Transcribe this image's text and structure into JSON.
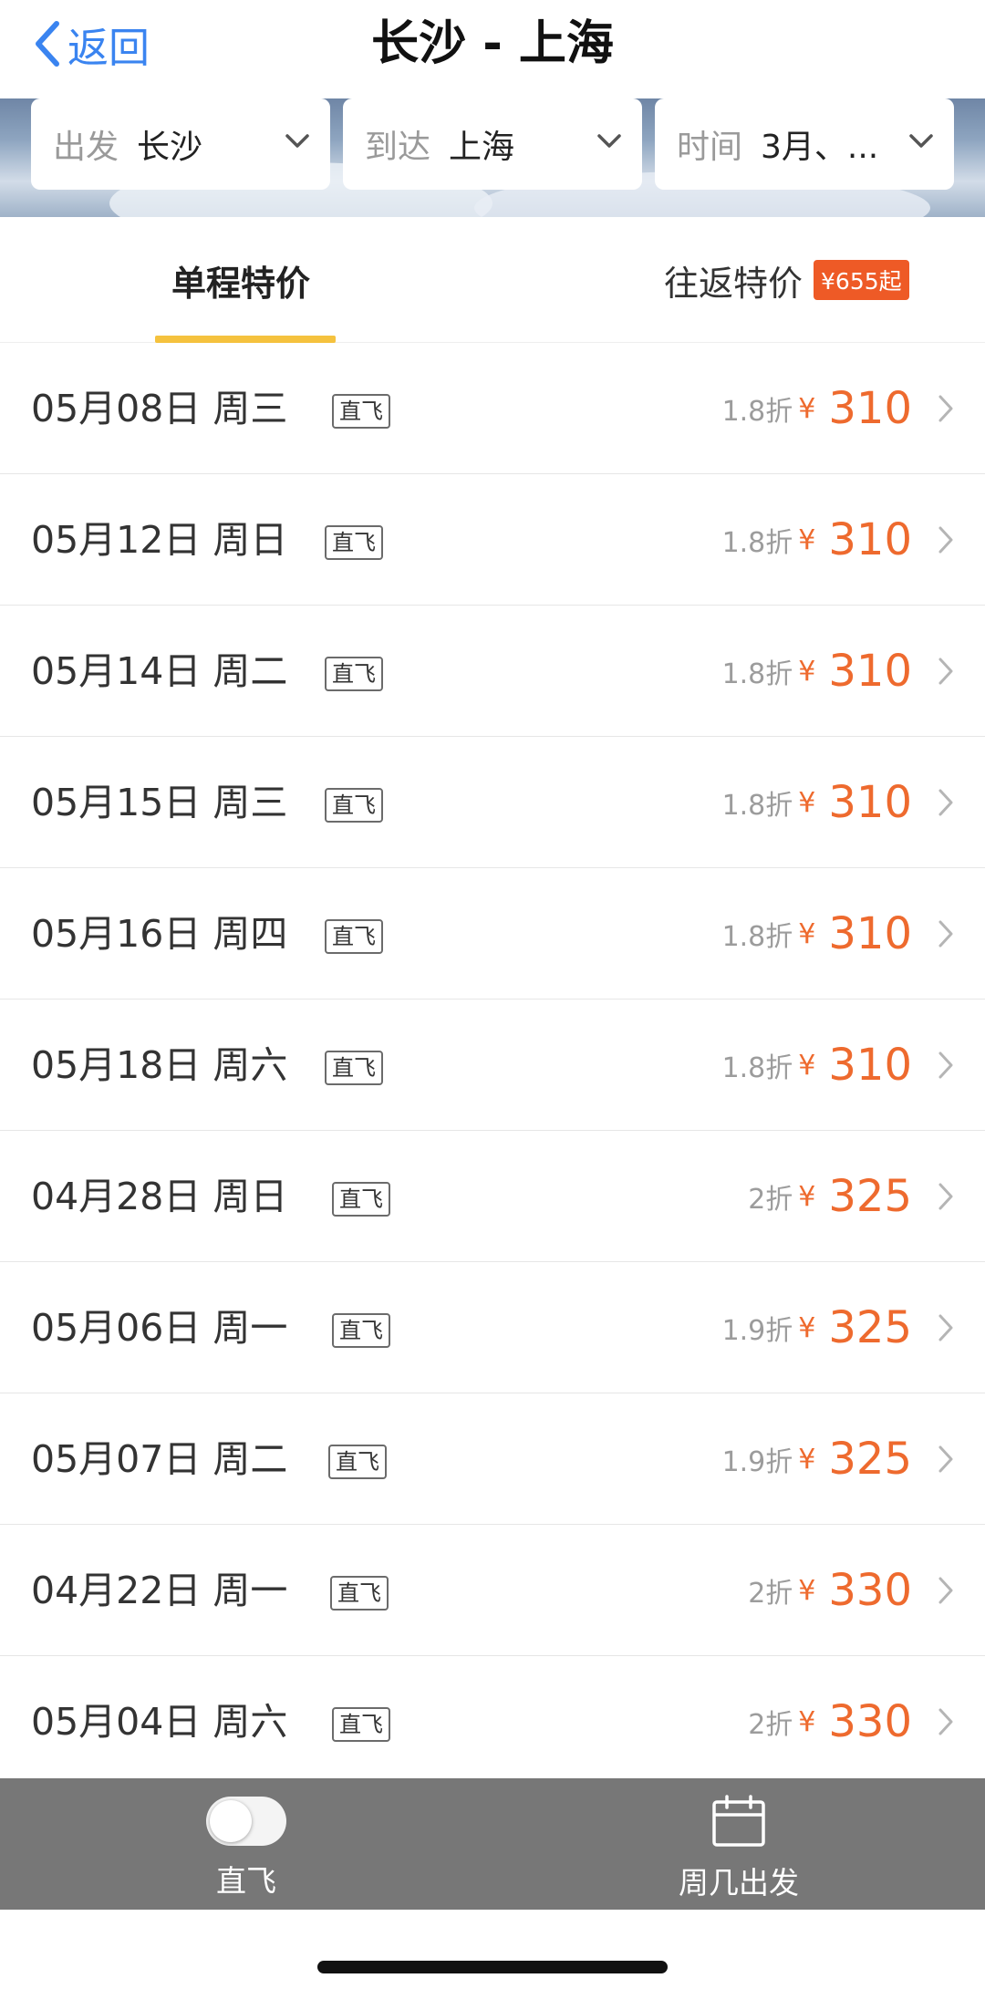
{
  "nav": {
    "back_label": "返回",
    "title": "长沙 - 上海"
  },
  "filters": [
    {
      "label": "出发",
      "value": "长沙"
    },
    {
      "label": "到达",
      "value": "上海"
    },
    {
      "label": "时间",
      "value": "3月、..."
    }
  ],
  "tabs": {
    "single": "单程特价",
    "round": "往返特价",
    "round_badge": "¥655起",
    "active": "single"
  },
  "currency_symbol": "¥",
  "flights": [
    {
      "date": "05月08日 周三",
      "tag": "直飞",
      "discount": "1.8折",
      "price": "310"
    },
    {
      "date": "05月12日 周日",
      "tag": "直飞",
      "discount": "1.8折",
      "price": "310"
    },
    {
      "date": "05月14日 周二",
      "tag": "直飞",
      "discount": "1.8折",
      "price": "310"
    },
    {
      "date": "05月15日 周三",
      "tag": "直飞",
      "discount": "1.8折",
      "price": "310"
    },
    {
      "date": "05月16日 周四",
      "tag": "直飞",
      "discount": "1.8折",
      "price": "310"
    },
    {
      "date": "05月18日 周六",
      "tag": "直飞",
      "discount": "1.8折",
      "price": "310"
    },
    {
      "date": "04月28日 周日",
      "tag": "直飞",
      "discount": "2折",
      "price": "325"
    },
    {
      "date": "05月06日 周一",
      "tag": "直飞",
      "discount": "1.9折",
      "price": "325"
    },
    {
      "date": "05月07日 周二",
      "tag": "直飞",
      "discount": "1.9折",
      "price": "325"
    },
    {
      "date": "04月22日 周一",
      "tag": "直飞",
      "discount": "2折",
      "price": "330"
    },
    {
      "date": "05月04日 周六",
      "tag": "直飞",
      "discount": "2折",
      "price": "330"
    }
  ],
  "bottom_bar": {
    "direct_label": "直飞",
    "direct_toggle_on": false,
    "weekday_label": "周几出发"
  },
  "colors": {
    "accent_blue": "#3a84f0",
    "price_orange": "#ee6a2e",
    "badge_orange": "#ee5a26",
    "tab_underline": "#f5c23e",
    "bottom_bar": "#777777"
  },
  "icons": {
    "back": "chevron-left-icon",
    "dropdown": "chevron-down-icon",
    "row_arrow": "chevron-right-icon",
    "toggle": "toggle-switch-icon",
    "calendar": "calendar-icon"
  }
}
